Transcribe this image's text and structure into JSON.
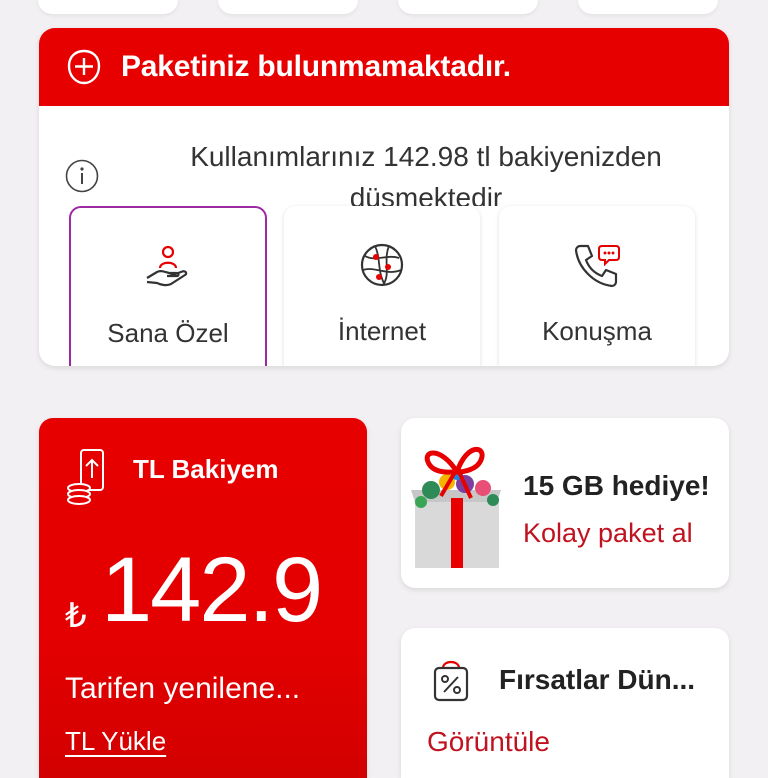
{
  "package": {
    "title": "Paketiniz bulunmamaktadır.",
    "info": "Kullanımlarınız 142.98 tl bakiyenizden düşmektedir",
    "tiles": [
      {
        "label": "Sana Özel",
        "icon": "hand-gift-icon",
        "selected": true
      },
      {
        "label": "İnternet",
        "icon": "globe-icon",
        "selected": false
      },
      {
        "label": "Konuşma",
        "icon": "phone-chat-icon",
        "selected": false
      }
    ]
  },
  "balance": {
    "title": "TL Bakiyem",
    "currency": "₺",
    "amount": "142.9",
    "renew_text": "Tarifen yenilene...",
    "topup_label": "TL Yükle"
  },
  "gift": {
    "title": "15 GB hediye!",
    "link": "Kolay paket al"
  },
  "deals": {
    "title": "Fırsatlar Dün...",
    "link": "Görüntüle"
  },
  "colors": {
    "accent": "#e60000",
    "selected_border": "#9c2aa0",
    "link_red": "#c1121f"
  }
}
